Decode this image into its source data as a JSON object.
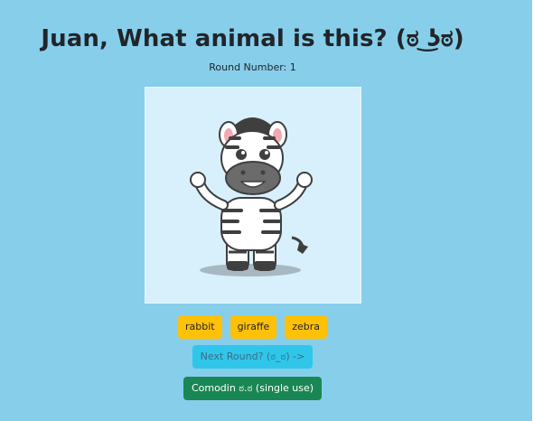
{
  "header": {
    "title": "Juan, What animal is this? (ಠ ͜ʖಠ)",
    "round_label": "Round Number: 1"
  },
  "image": {
    "icon": "zebra-icon"
  },
  "choices": [
    {
      "label": "rabbit"
    },
    {
      "label": "giraffe"
    },
    {
      "label": "zebra"
    }
  ],
  "actions": {
    "next_round": "Next Round? (ಠ_ಠ) ->",
    "comodin": "Comodin ಠ.ಠ (single use)"
  },
  "colors": {
    "background": "#87ceeb",
    "choice": "#ffc107",
    "next": "#2fc6ea",
    "comodin": "#198754"
  }
}
